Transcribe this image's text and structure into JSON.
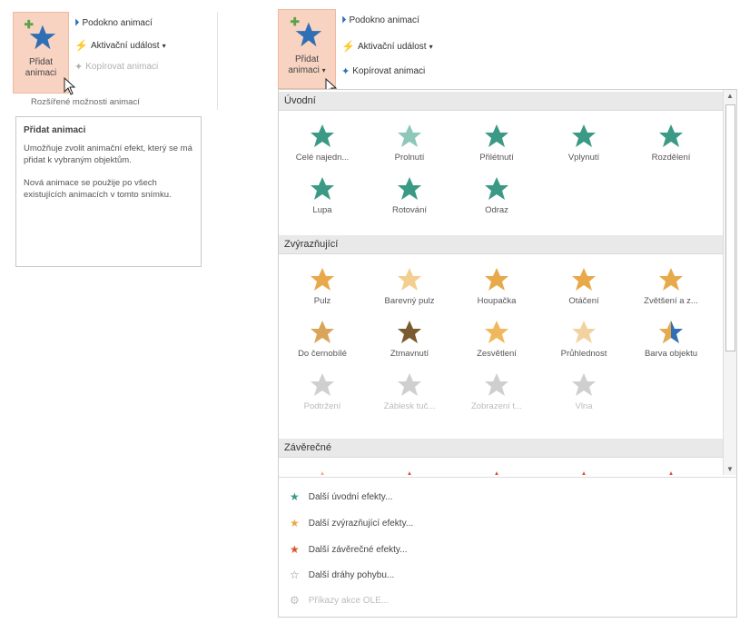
{
  "left": {
    "add_animation_label_1": "Přidat",
    "add_animation_label_2": "animaci",
    "animation_pane": "Podokno animací",
    "trigger": "Aktivační událost",
    "trigger_arrow": "▾",
    "copy_animation": "Kopírovat animaci",
    "group_label": "Rozšířené možnosti animací",
    "tooltip_title": "Přidat animaci",
    "tooltip_p1": "Umožňuje zvolit animační efekt, který se má přidat k vybraným objektům.",
    "tooltip_p2": "Nová animace se použije po všech existujících animacích v tomto snímku."
  },
  "right": {
    "add_animation_label_1": "Přidat",
    "add_animation_label_2": "animaci",
    "add_animation_arrow": "▾",
    "animation_pane": "Podokno animací",
    "trigger": "Aktivační událost",
    "trigger_arrow": "▾",
    "copy_animation": "Kopírovat animaci"
  },
  "gallery": {
    "sections": [
      {
        "title": "Úvodní",
        "items": [
          "Celé najedn...",
          "Prolnutí",
          "Přilétnutí",
          "Vplynutí",
          "Rozdělení",
          "Lupa",
          "Rotování",
          "Odraz"
        ]
      },
      {
        "title": "Zvýrazňující",
        "items": [
          "Pulz",
          "Barevný pulz",
          "Houpačka",
          "Otáčení",
          "Zvětšení a z...",
          "Do černobílé",
          "Ztmavnutí",
          "Zesvětlení",
          "Průhlednost",
          "Barva objektu",
          "Podtržení",
          "Záblesk tuč...",
          "Zobrazení t...",
          "Vlna"
        ]
      },
      {
        "title": "Závěrečné",
        "items": [
          "",
          "",
          "",
          "",
          ""
        ]
      }
    ],
    "menu": [
      {
        "label": "Další úvodní efekty...",
        "color": "#3a9a86"
      },
      {
        "label": "Další zvýrazňující efekty...",
        "color": "#e8a94a"
      },
      {
        "label": "Další závěrečné efekty...",
        "color": "#d9532c"
      },
      {
        "label": "Další dráhy pohybu...",
        "color": "#888888"
      },
      {
        "label": "Příkazy akce OLE...",
        "color": "#bbbbbb"
      }
    ]
  },
  "colors": {
    "entrance": "#3a9a86",
    "emphasis": "#e8a94a",
    "exit": "#d9532c",
    "disabled": "#c8c8c8",
    "selected_bg": "#f8d3c2"
  }
}
